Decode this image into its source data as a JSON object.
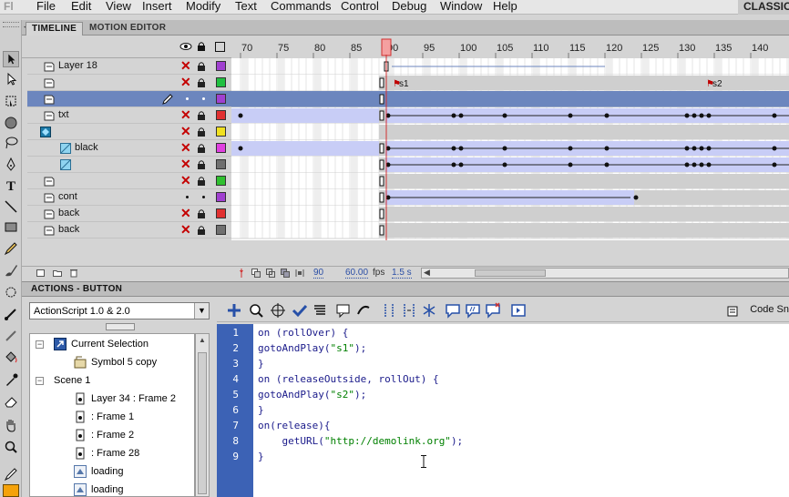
{
  "app": {
    "logo": "Fl",
    "menu": [
      "File",
      "Edit",
      "View",
      "Insert",
      "Modify",
      "Text",
      "Commands",
      "Control",
      "Debug",
      "Window",
      "Help"
    ],
    "workspace": "CLASSIC"
  },
  "timeline": {
    "tabs": [
      "TIMELINE",
      "MOTION EDITOR"
    ],
    "ruler": [
      "70",
      "75",
      "80",
      "85",
      "90",
      "95",
      "100",
      "105",
      "110",
      "115",
      "120",
      "125",
      "130",
      "135",
      "140"
    ],
    "playhead": "90",
    "frame_labels": [
      "s1",
      "s2"
    ],
    "layers": [
      {
        "name": "Layer 18",
        "icon": "layer-icon",
        "hidden": true,
        "locked": true,
        "color": "#a040d0"
      },
      {
        "name": "",
        "icon": "layer-icon",
        "hidden": true,
        "locked": true,
        "color": "#20c040"
      },
      {
        "name": "",
        "icon": "layer-icon",
        "selected": true,
        "editing": true,
        "color": "#a040d0"
      },
      {
        "name": "txt",
        "icon": "layer-icon",
        "hidden": true,
        "locked": true,
        "color": "#e03030"
      },
      {
        "name": "",
        "icon": "mask-layer-icon",
        "hidden": true,
        "locked": true,
        "color": "#f0e020"
      },
      {
        "name": "black",
        "icon": "masked-layer-icon",
        "hidden": true,
        "locked": true,
        "color": "#e040e0"
      },
      {
        "name": "",
        "icon": "masked-layer-icon",
        "hidden": true,
        "locked": true,
        "color": "#707070"
      },
      {
        "name": "",
        "icon": "layer-icon",
        "hidden": true,
        "locked": true,
        "color": "#30c030"
      },
      {
        "name": "cont",
        "icon": "layer-icon",
        "hidden": false,
        "locked": false,
        "color": "#a040d0"
      },
      {
        "name": "back",
        "icon": "layer-icon",
        "hidden": true,
        "locked": true,
        "color": "#e03030"
      },
      {
        "name": "back",
        "icon": "layer-icon",
        "hidden": true,
        "locked": true,
        "color": "#707070"
      }
    ],
    "status": {
      "current_frame": "90",
      "fps": "60.00",
      "fps_unit": "fps",
      "elapsed": "1.5 s"
    }
  },
  "actions": {
    "title": "ACTIONS - BUTTON",
    "language": "ActionScript 1.0 & 2.0",
    "code_snippets_label": "Code Sn",
    "tree": [
      {
        "label": "Current Selection",
        "level": 0,
        "expander": "−",
        "icon": "current-selection-icon"
      },
      {
        "label": "Symbol 5 copy",
        "level": 1,
        "icon": "button-symbol-icon"
      },
      {
        "label": "Scene 1",
        "level": 0,
        "expander": "−",
        "icon": ""
      },
      {
        "label": "Layer 34 : Frame 2",
        "level": 1,
        "icon": "frame-script-icon"
      },
      {
        "label": ": Frame 1",
        "level": 1,
        "icon": "frame-script-icon"
      },
      {
        "label": ": Frame 2",
        "level": 1,
        "icon": "frame-script-icon"
      },
      {
        "label": ": Frame 28",
        "level": 1,
        "icon": "frame-script-icon"
      },
      {
        "label": "loading",
        "level": 1,
        "icon": "movieclip-icon"
      },
      {
        "label": "loading",
        "level": 1,
        "icon": "movieclip-icon"
      }
    ],
    "code": [
      {
        "n": "1",
        "text": "on (rollOver) {"
      },
      {
        "n": "2",
        "text": "gotoAndPlay(\"s1\");"
      },
      {
        "n": "3",
        "text": "}"
      },
      {
        "n": "4",
        "text": "on (releaseOutside, rollOut) {"
      },
      {
        "n": "5",
        "text": "gotoAndPlay(\"s2\");"
      },
      {
        "n": "6",
        "text": "}"
      },
      {
        "n": "7",
        "text": "on(release){"
      },
      {
        "n": "8",
        "text": "    getURL(\"http://demolink.org\");"
      },
      {
        "n": "9",
        "text": "}"
      }
    ]
  },
  "colors": {
    "selection": "#6c86be",
    "gutter": "#3c62b5",
    "playhead": "#e03030",
    "tween": "#c8cdf6"
  }
}
